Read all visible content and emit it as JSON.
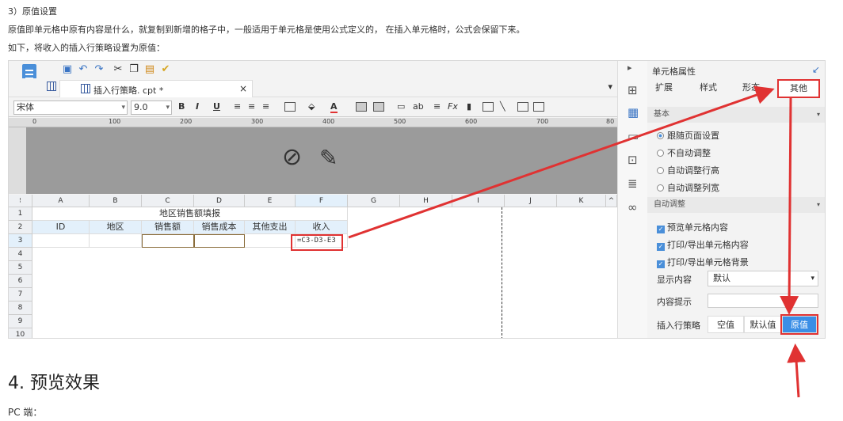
{
  "doc": {
    "step": "3）原值设置",
    "desc": "原值即单元格中原有内容是什么，就复制到新增的格子中，一般适用于单元格是使用公式定义的， 在插入单元格时，公式会保留下来。",
    "intro": "如下，将收入的插入行策略设置为原值：",
    "heading": "4. 预览效果",
    "pc_label": "PC 端："
  },
  "editor": {
    "tab_title": "插入行策略. cpt *",
    "font_name": "宋体",
    "font_size": "9.0",
    "ruler_ticks": [
      "0",
      "100",
      "200",
      "300",
      "400",
      "500",
      "600",
      "700",
      "80"
    ],
    "columns": [
      "A",
      "B",
      "C",
      "D",
      "E",
      "F",
      "G",
      "H",
      "I",
      "J",
      "K"
    ],
    "rows": [
      "1",
      "2",
      "3",
      "4",
      "5",
      "6",
      "7",
      "8",
      "9",
      "10"
    ],
    "title_cell": "地区销售额填报",
    "headers": [
      "ID",
      "地区",
      "销售额",
      "销售成本",
      "其他支出",
      "收入"
    ],
    "formula": "=C3-D3-E3"
  },
  "panel": {
    "title": "单元格属性",
    "tabs": [
      "扩展",
      "样式",
      "形态",
      "其他"
    ],
    "section_basic": "基本",
    "radios": [
      "跟随页面设置",
      "不自动调整",
      "自动调整行高",
      "自动调整列宽"
    ],
    "section_auto": "自动调整",
    "checks": [
      "预览单元格内容",
      "打印/导出单元格内容",
      "打印/导出单元格背景"
    ],
    "display_label": "显示内容",
    "display_value": "默认",
    "hint_label": "内容提示",
    "insert_label": "插入行策略",
    "insert_options": [
      "空值",
      "默认值",
      "原值"
    ]
  },
  "colors": {
    "accent": "#3a8ee6",
    "highlight": "#e03232",
    "brand_blue": "#4a8fd9"
  }
}
